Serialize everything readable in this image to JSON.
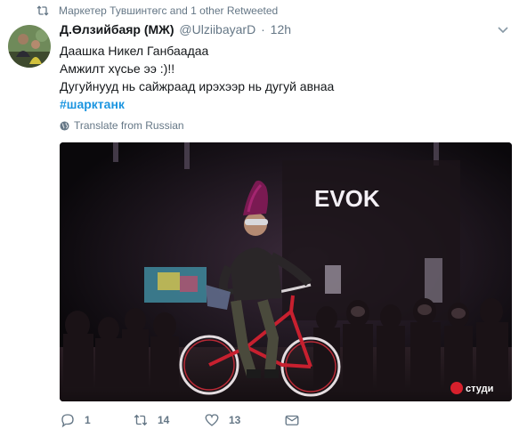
{
  "retweet_context": {
    "text": "Маркетер Тувшинтөгс and 1 other Retweeted"
  },
  "tweet": {
    "author_name": "Д.Өлзийбаяр (МЖ)",
    "handle": "@UlziibayarD",
    "separator": "·",
    "time": "12h",
    "lines": [
      "Даашка Никел Ганбаадаа",
      "Амжилт хүсье ээ :)!!",
      "Дугуйнууд нь сайжраад ирэхээр нь дугуй авнаа"
    ],
    "hashtag": "#шарктанк",
    "translate_label": "Translate from Russian"
  },
  "media": {
    "sign_text": "EVOK",
    "watermark": "студи"
  },
  "actions": {
    "reply_count": "1",
    "retweet_count": "14",
    "like_count": "13"
  },
  "colors": {
    "link": "#1b95e0",
    "muted": "#657786",
    "text": "#14171a"
  }
}
